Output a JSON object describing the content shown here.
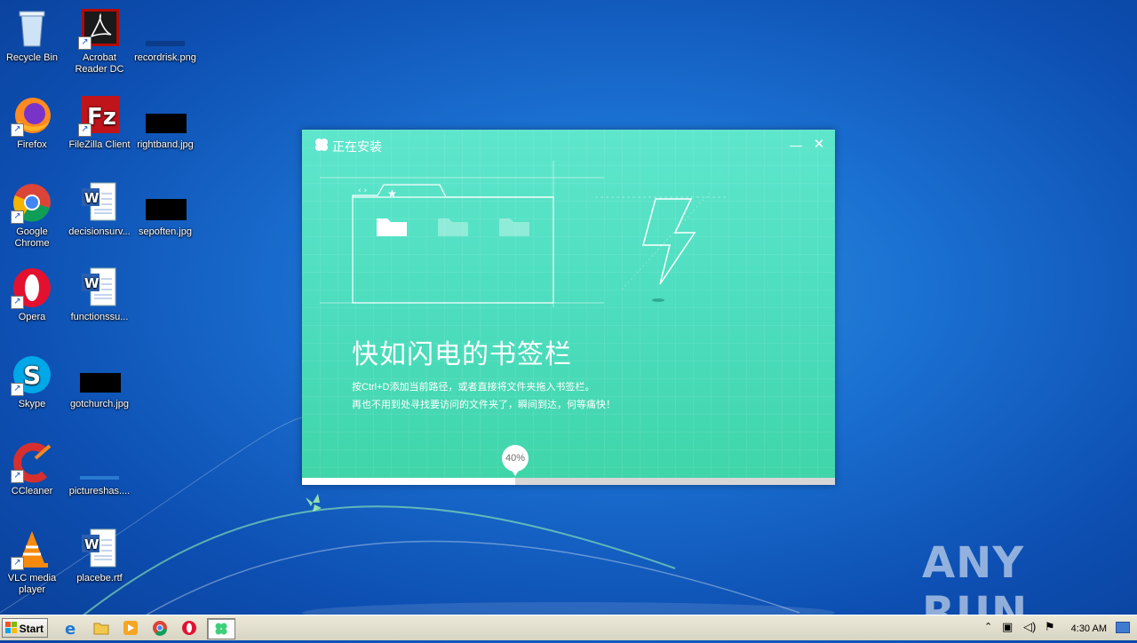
{
  "desktop": {
    "icons": [
      {
        "label": "Recycle Bin"
      },
      {
        "label": "Acrobat Reader DC"
      },
      {
        "label": "recordrisk.png"
      },
      {
        "label": "Firefox"
      },
      {
        "label": "FileZilla Client"
      },
      {
        "label": "rightband.jpg"
      },
      {
        "label": "Google Chrome"
      },
      {
        "label": "decisionsurv..."
      },
      {
        "label": "sepoften.jpg"
      },
      {
        "label": "Opera"
      },
      {
        "label": "functionssu..."
      },
      {
        "label": "Skype"
      },
      {
        "label": "gotchurch.jpg"
      },
      {
        "label": "CCleaner"
      },
      {
        "label": "pictureshas...."
      },
      {
        "label": "VLC media player"
      },
      {
        "label": "placebe.rtf"
      }
    ]
  },
  "installer": {
    "title": "正在安装",
    "minimize_glyph": "—",
    "close_glyph": "✕",
    "headline": "快如闪电的书签栏",
    "desc_line1": "按Ctrl+D添加当前路径，或者直接将文件夹拖入书签栏。",
    "desc_line2": "再也不用到处寻找要访问的文件夹了，瞬间到达，何等痛快！",
    "progress_label": "40%",
    "progress_value": 0.4
  },
  "taskbar": {
    "start_label": "Start",
    "items": [
      "ie-icon",
      "explorer-icon",
      "media-player-icon",
      "chrome-icon",
      "opera-icon",
      "installer-app-icon"
    ],
    "clock": "4:30 AM"
  },
  "watermark": "ANY RUN",
  "colors": {
    "accent": "#4cdcbd",
    "desktop": "#1a6fd0"
  }
}
